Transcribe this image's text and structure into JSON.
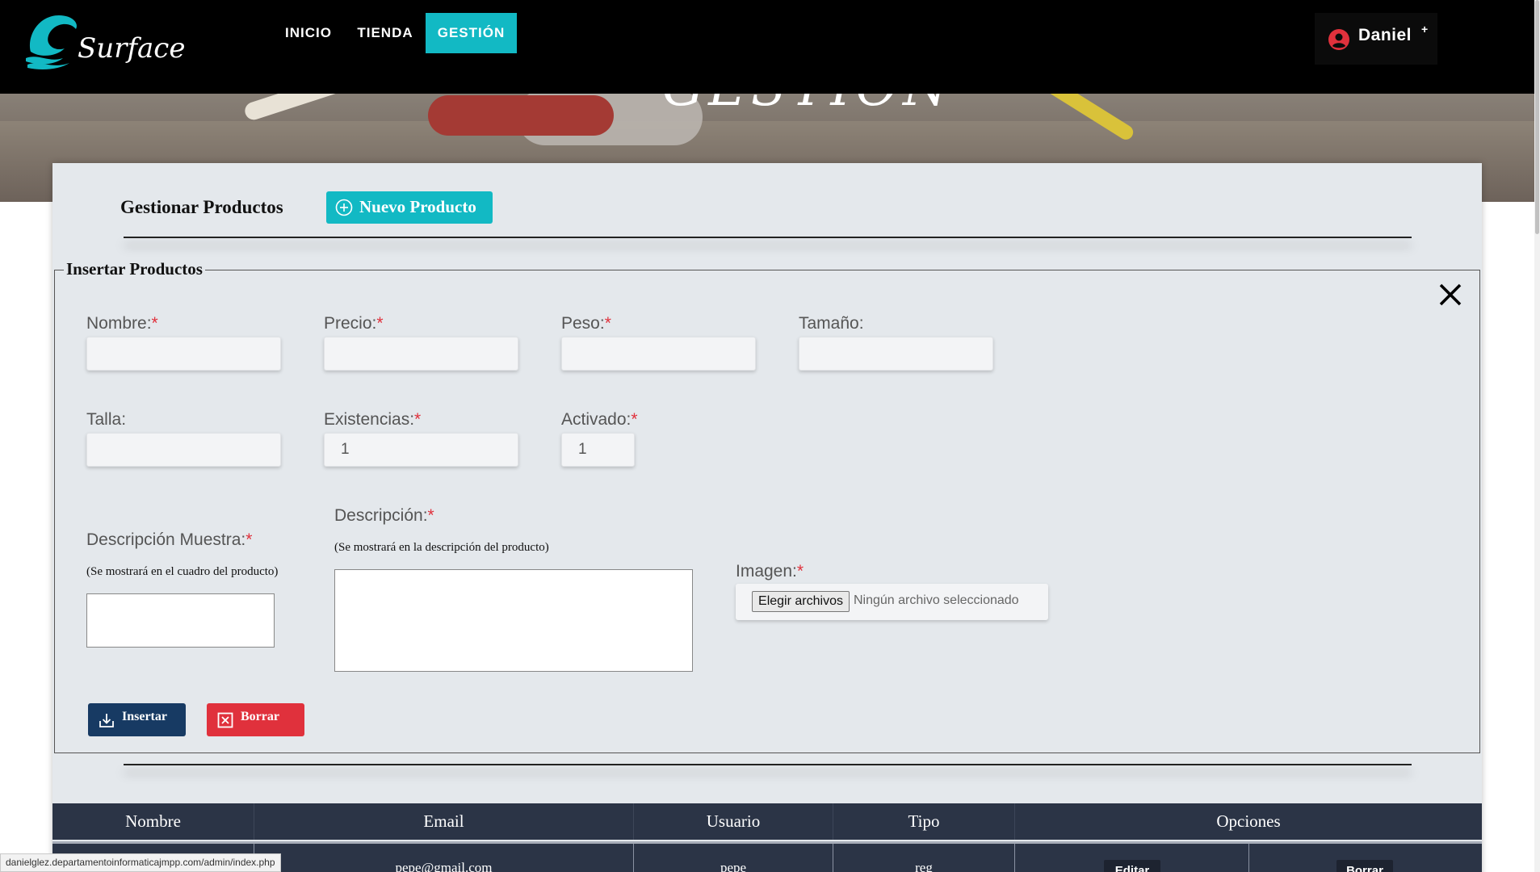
{
  "hero": {
    "title": "GESTIÓN"
  },
  "navbar": {
    "logo_text": "Surface",
    "links": [
      {
        "label": "INICIO",
        "active": false
      },
      {
        "label": "TIENDA",
        "active": false
      },
      {
        "label": "GESTIÓN",
        "active": true
      }
    ],
    "user": {
      "name": "Daniel",
      "plus": "+"
    },
    "colors": {
      "accent": "#12b9c4",
      "user_icon": "#e0313c"
    }
  },
  "panel": {
    "title": "Gestionar Productos",
    "new_button": "Nuevo Producto"
  },
  "form": {
    "legend": "Insertar Productos",
    "fields": {
      "nombre": {
        "label": "Nombre:",
        "required": "*",
        "value": ""
      },
      "precio": {
        "label": "Precio:",
        "required": "*",
        "value": ""
      },
      "peso": {
        "label": "Peso:",
        "required": "*",
        "value": ""
      },
      "tamano": {
        "label": "Tamaño:",
        "value": ""
      },
      "talla": {
        "label": "Talla:",
        "value": ""
      },
      "existencias": {
        "label": "Existencias:",
        "required": "*",
        "value": "1"
      },
      "activado": {
        "label": "Activado:",
        "required": "*",
        "value": "1"
      },
      "descripcion_muestra": {
        "label": "Descripción Muestra:",
        "required": "*",
        "hint": "(Se mostrará en el cuadro del producto)"
      },
      "descripcion": {
        "label": "Descripción:",
        "required": "*",
        "hint": "(Se mostrará en la descripción del producto)"
      },
      "imagen": {
        "label": "Imagen:",
        "required": "*",
        "button": "Elegir archivos",
        "status": "Ningún archivo seleccionado"
      }
    },
    "buttons": {
      "insertar": "Insertar",
      "borrar": "Borrar"
    }
  },
  "table": {
    "headers": [
      "Nombre",
      "Email",
      "Usuario",
      "Tipo",
      "Opciones"
    ],
    "rows": [
      {
        "nombre": "",
        "email": "pepe@gmail.com",
        "usuario": "pepe",
        "tipo": "reg",
        "editar": "Editar",
        "borrar": "Borrar"
      }
    ]
  },
  "status_bar": {
    "url": "danielglez.departamentoinformaticajmpp.com/admin/index.php"
  }
}
